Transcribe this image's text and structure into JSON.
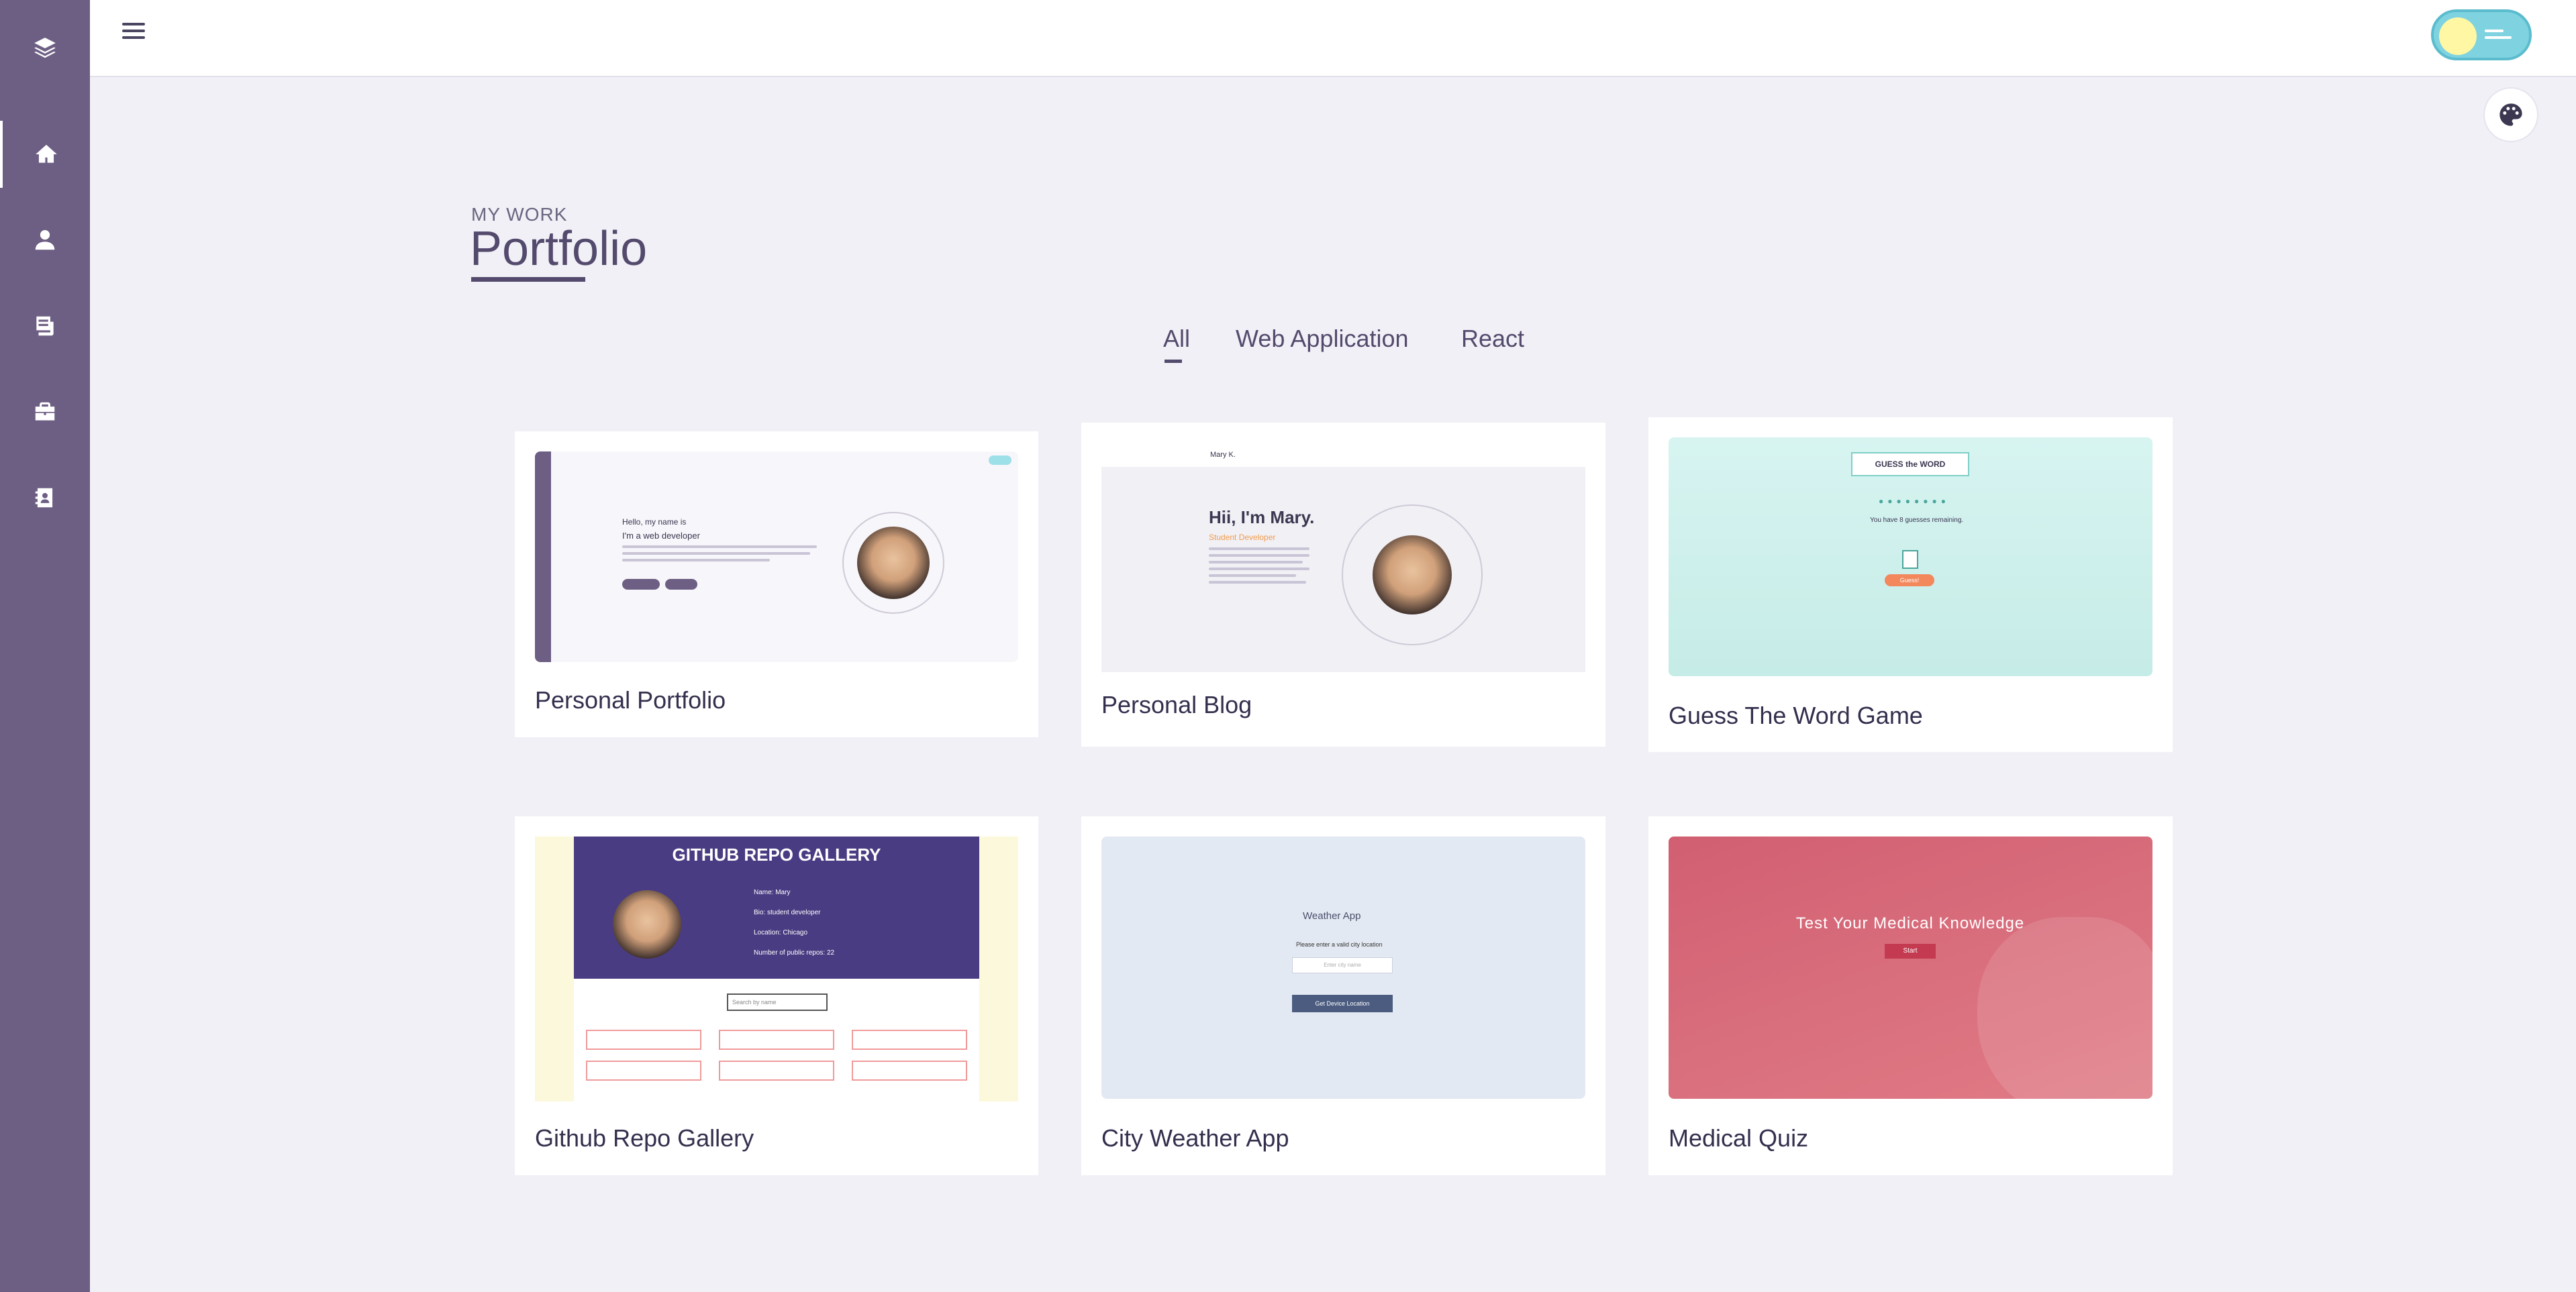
{
  "sidebar": {
    "items": [
      {
        "name": "logo",
        "icon": "layers-icon"
      },
      {
        "name": "home",
        "icon": "home-icon"
      },
      {
        "name": "about",
        "icon": "user-icon"
      },
      {
        "name": "blog",
        "icon": "news-icon"
      },
      {
        "name": "portfolio",
        "icon": "briefcase-icon"
      },
      {
        "name": "contact",
        "icon": "contact-card-icon"
      }
    ]
  },
  "header": {
    "menu_icon": "hamburger-menu-icon",
    "theme_toggle_icon": "theme-toggle-icon",
    "palette_icon": "palette-icon"
  },
  "section": {
    "subtitle": "MY WORK",
    "title": "Portfolio"
  },
  "filters": {
    "all": "All",
    "web": "Web Application",
    "react": "React",
    "active": "All"
  },
  "projects": [
    {
      "title": "Personal Portfolio"
    },
    {
      "title": "Personal Blog"
    },
    {
      "title": "Guess The Word Game"
    },
    {
      "title": "Github Repo Gallery"
    },
    {
      "title": "City Weather App"
    },
    {
      "title": "Medical Quiz"
    }
  ],
  "previews": {
    "portfolio": {
      "greeting": "Hello, my name is",
      "role": "I'm a web developer"
    },
    "blog": {
      "brand": "Mary K.",
      "heading": "Hii, I'm Mary.",
      "role": "Student Developer"
    },
    "word": {
      "logo": "GUESS the WORD",
      "remaining": "You have 8 guesses remaining.",
      "button": "Guess!"
    },
    "gallery": {
      "heading": "GITHUB REPO GALLERY",
      "name": "Name: Mary",
      "bio": "Bio: student developer",
      "location": "Location: Chicago",
      "repos": "Number of public repos: 22",
      "search": "Search by name"
    },
    "weather": {
      "title": "Weather App",
      "prompt": "Please enter a valid city location",
      "placeholder": "Enter city name",
      "button": "Get Device Location"
    },
    "quiz": {
      "title": "Test Your Medical Knowledge",
      "button": "Start"
    }
  },
  "colors": {
    "sidebar": "#6d5e83",
    "accent": "#544a6d",
    "background": "#f1f0f6"
  }
}
